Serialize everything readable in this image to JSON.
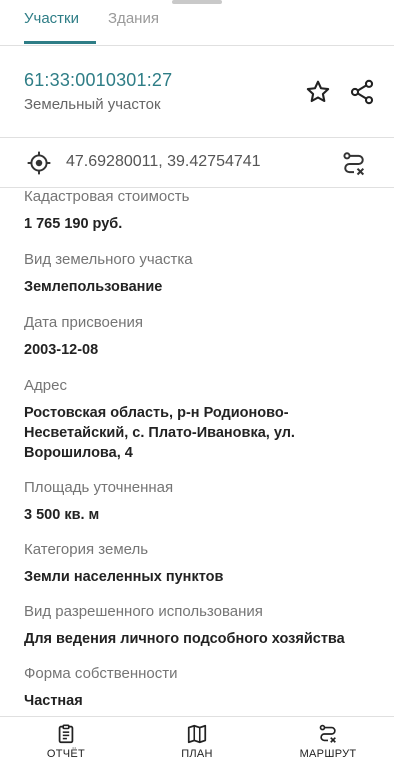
{
  "tabs": [
    {
      "label": "Участки"
    },
    {
      "label": "Здания"
    }
  ],
  "header": {
    "cadastral_number": "61:33:0010301:27",
    "object_type": "Земельный участок"
  },
  "coordinates": {
    "text": "47.69280011, 39.42754741"
  },
  "fields": [
    {
      "label": "Кадастровая стоимость",
      "value": "1 765 190 руб."
    },
    {
      "label": "Вид земельного участка",
      "value": "Землепользование"
    },
    {
      "label": "Дата присвоения",
      "value": "2003-12-08"
    },
    {
      "label": "Адрес",
      "value": "Ростовская область, р-н Родионово-Несветайский, с. Плато-Ивановка, ул. Ворошилова,  4"
    },
    {
      "label": "Площадь уточненная",
      "value": "3 500 кв. м"
    },
    {
      "label": "Категория земель",
      "value": "Земли населенных пунктов"
    },
    {
      "label": "Вид разрешенного использования",
      "value": "Для ведения личного подсобного хозяйства"
    },
    {
      "label": "Форма собственности",
      "value": "Частная"
    }
  ],
  "bottom_nav": [
    {
      "label": "ОТЧЁТ",
      "icon": "clipboard-icon"
    },
    {
      "label": "ПЛАН",
      "icon": "map-icon"
    },
    {
      "label": "МАРШРУТ",
      "icon": "route-icon"
    }
  ],
  "colors": {
    "accent": "#2e7d86",
    "label": "#757575",
    "divider": "#e0e0e0"
  }
}
